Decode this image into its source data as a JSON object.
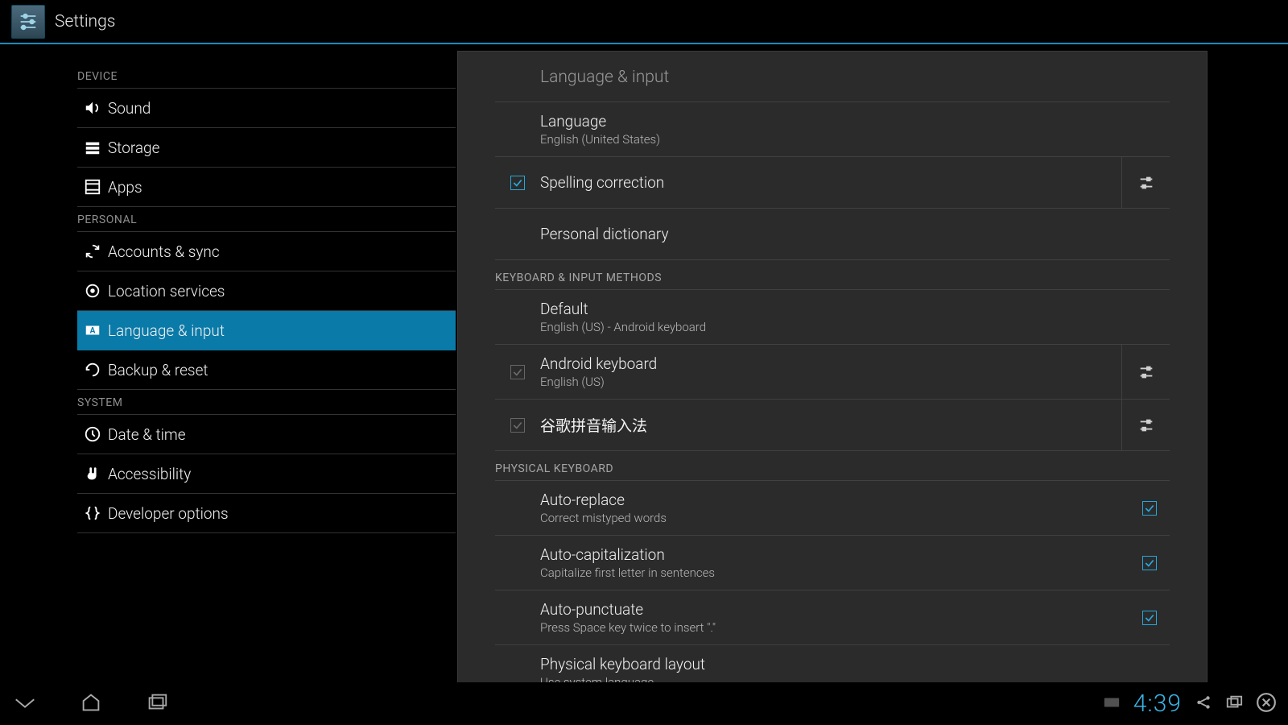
{
  "app_title": "Settings",
  "sidebar": {
    "sections": [
      {
        "header": "DEVICE",
        "items": [
          {
            "id": "sound",
            "label": "Sound",
            "icon": "speaker"
          },
          {
            "id": "storage",
            "label": "Storage",
            "icon": "storage"
          },
          {
            "id": "apps",
            "label": "Apps",
            "icon": "apps"
          }
        ]
      },
      {
        "header": "PERSONAL",
        "items": [
          {
            "id": "accounts",
            "label": "Accounts & sync",
            "icon": "sync"
          },
          {
            "id": "location",
            "label": "Location services",
            "icon": "location"
          },
          {
            "id": "language",
            "label": "Language & input",
            "icon": "keyboard-a",
            "selected": true
          },
          {
            "id": "backup",
            "label": "Backup & reset",
            "icon": "backup"
          }
        ]
      },
      {
        "header": "SYSTEM",
        "items": [
          {
            "id": "datetime",
            "label": "Date & time",
            "icon": "clock"
          },
          {
            "id": "accessibility",
            "label": "Accessibility",
            "icon": "hand"
          },
          {
            "id": "developer",
            "label": "Developer options",
            "icon": "braces"
          }
        ]
      }
    ]
  },
  "pane": {
    "title": "Language & input",
    "language": {
      "label": "Language",
      "value": "English (United States)"
    },
    "spelling": {
      "label": "Spelling correction",
      "checked": true,
      "has_settings": true
    },
    "dictionary": {
      "label": "Personal dictionary"
    },
    "keyboard_header": "KEYBOARD & INPUT METHODS",
    "default_ime": {
      "label": "Default",
      "value": "English (US) - Android keyboard"
    },
    "imes": [
      {
        "label": "Android keyboard",
        "sub": "English (US)",
        "checked": true,
        "dim": true,
        "has_settings": true
      },
      {
        "label": "谷歌拼音输入法",
        "sub": "",
        "checked": true,
        "dim": true,
        "has_settings": true
      }
    ],
    "physical_header": "PHYSICAL KEYBOARD",
    "physical": [
      {
        "label": "Auto-replace",
        "sub": "Correct mistyped words",
        "checked": true
      },
      {
        "label": "Auto-capitalization",
        "sub": "Capitalize first letter in sentences",
        "checked": true
      },
      {
        "label": "Auto-punctuate",
        "sub": "Press Space key twice to insert \".\"",
        "checked": true
      }
    ],
    "layout": {
      "label": "Physical keyboard layout",
      "sub": "Use system language"
    }
  },
  "statusbar": {
    "time": "4:39"
  }
}
